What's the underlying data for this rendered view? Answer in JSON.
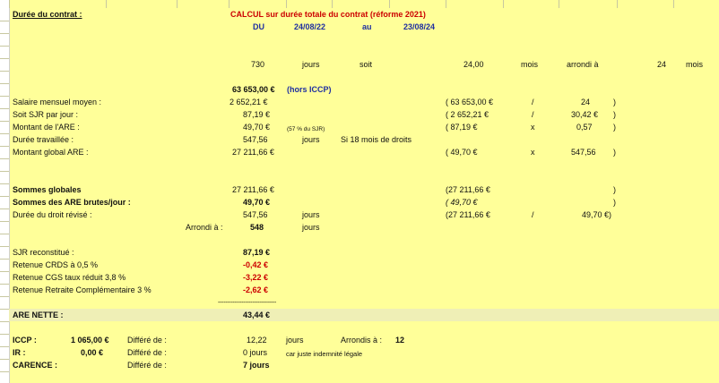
{
  "header": {
    "duree_label": "Durée du contrat  :",
    "calcul_title": "CALCUL sur durée totale du contrat (réforme 2021)",
    "du_label": "DU",
    "du_date": "24/08/22",
    "au_label": "au",
    "au_date": "23/08/24"
  },
  "days_row": {
    "days": "730",
    "jours": "jours",
    "soit": "soit",
    "months": "24,00",
    "mois": "mois",
    "arrondi": "arrondi à",
    "rounded": "24",
    "mois2": "mois"
  },
  "total_salary": {
    "value": "63 653,00 €",
    "note": "(hors ICCP)"
  },
  "rows": {
    "salaire": {
      "label": "Salaire mensuel moyen :",
      "value": "2 652,21 €",
      "f1": "( 63 653,00 €",
      "op": "/",
      "f2": "24",
      "close": ")"
    },
    "sjr": {
      "label": "Soit SJR par jour :",
      "value": "87,19 €",
      "f1": "( 2 652,21 €",
      "op": "/",
      "f2": "30,42 €",
      "close": ")"
    },
    "are": {
      "label": "Montant de l'ARE :",
      "value": "49,70 €",
      "note": "(57 % du  SJR)",
      "f1": "(    87,19 €",
      "op": "x",
      "f2": "0,57",
      "close": ")"
    },
    "duree": {
      "label": "Durée travaillée :",
      "value": "547,56",
      "unit": "jours",
      "note": "Si 18 mois de droits"
    },
    "global": {
      "label": "Montant global ARE :",
      "value": "27 211,66 €",
      "f1": "(    49,70 €",
      "op": "x",
      "f2": "547,56",
      "close": ")"
    }
  },
  "sommes": {
    "globales": {
      "label": "Sommes globales",
      "value": "27 211,66 €",
      "f1": "(27 211,66 €",
      "close": ")"
    },
    "are_brutes": {
      "label": "Sommes des ARE brutes/jour :",
      "value": "49,70 €",
      "f1": "(    49,70 €",
      "close": ")"
    },
    "revise": {
      "label": "Durée du droit révisé :",
      "value": "547,56",
      "unit": "jours",
      "f1": "(27 211,66 €",
      "op": "/",
      "f2": "49,70 €)"
    },
    "arrondi": {
      "label": "Arrondi à :",
      "value": "548",
      "unit": "jours"
    }
  },
  "retenues": {
    "sjr": {
      "label": "SJR reconstitué :",
      "value": "87,19 €"
    },
    "crds": {
      "label": "Retenue CRDS à 0,5 %",
      "value": "-0,42 €"
    },
    "cgs": {
      "label": "Retenue CGS taux réduit 3,8 %",
      "value": "-3,22 €"
    },
    "retraite": {
      "label": "Retenue Retraite Complémentaire 3 %",
      "value": "-2,62 €"
    },
    "dashes": "--------------------------------"
  },
  "nette": {
    "label": "ARE NETTE :",
    "value": "43,44 €"
  },
  "footer": {
    "iccp": {
      "label": "ICCP :",
      "amount": "1 065,00 €",
      "diff": "Différé de :",
      "value": "12,22",
      "unit": "jours",
      "arr_label": "Arrondis à :",
      "arr_value": "12"
    },
    "ir": {
      "label": "IR :",
      "amount": "0,00 €",
      "diff": "Différé de :",
      "value": "0 jours",
      "note": "car juste indemnité légale"
    },
    "carence": {
      "label": "CARENCE :",
      "diff": "Différé de :",
      "value": "7 jours"
    }
  },
  "colors": {
    "sheet_bg": "#ffff99",
    "red": "#cc0000",
    "blue": "#1f2fa0"
  }
}
